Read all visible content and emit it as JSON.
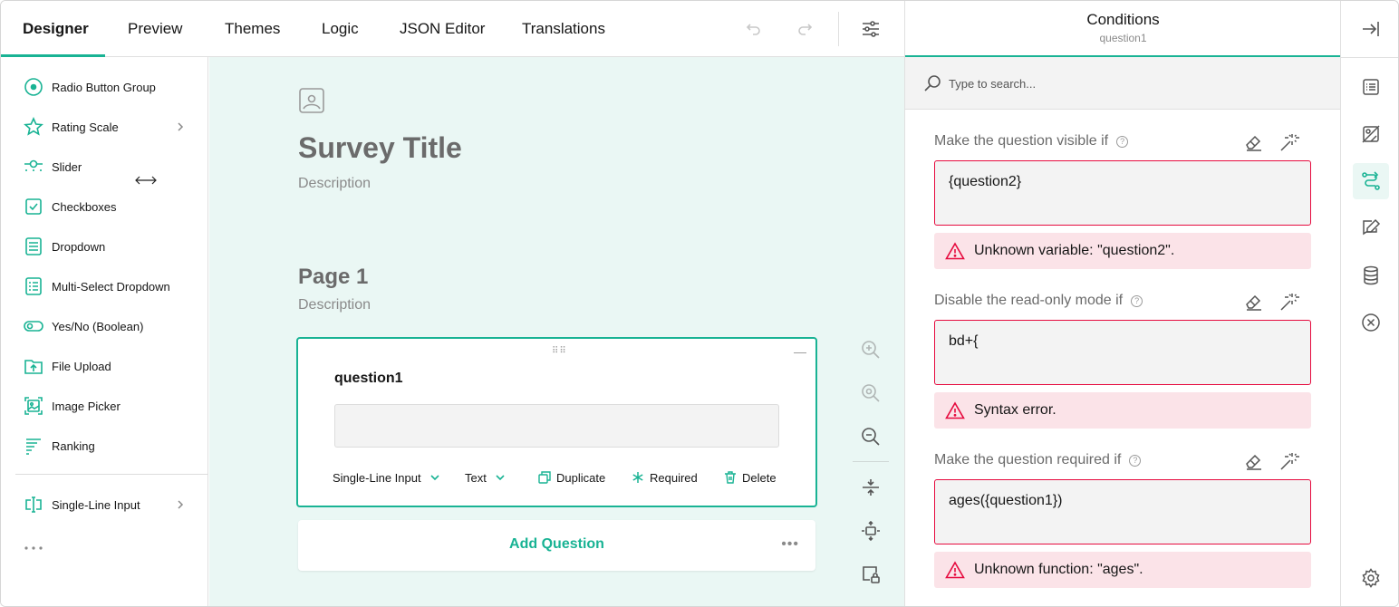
{
  "tabs": [
    {
      "label": "Designer",
      "active": true
    },
    {
      "label": "Preview"
    },
    {
      "label": "Themes"
    },
    {
      "label": "Logic"
    },
    {
      "label": "JSON Editor"
    },
    {
      "label": "Translations"
    }
  ],
  "toolbox": {
    "items": [
      {
        "label": "Radio Button Group",
        "icon": "radio-icon"
      },
      {
        "label": "Rating Scale",
        "icon": "star-icon",
        "has_submenu": true
      },
      {
        "label": "Slider",
        "icon": "slider-icon"
      },
      {
        "label": "Checkboxes",
        "icon": "checkbox-icon"
      },
      {
        "label": "Dropdown",
        "icon": "dropdown-icon"
      },
      {
        "label": "Multi-Select Dropdown",
        "icon": "multi-dropdown-icon"
      },
      {
        "label": "Yes/No (Boolean)",
        "icon": "toggle-icon"
      },
      {
        "label": "File Upload",
        "icon": "file-upload-icon"
      },
      {
        "label": "Image Picker",
        "icon": "image-picker-icon"
      },
      {
        "label": "Ranking",
        "icon": "ranking-icon"
      }
    ],
    "bottom_item": {
      "label": "Single-Line Input",
      "icon": "text-input-icon",
      "has_submenu": true
    }
  },
  "survey": {
    "title": "Survey Title",
    "description": "Description",
    "page": {
      "title": "Page 1",
      "description": "Description"
    }
  },
  "question": {
    "name": "question1",
    "type_label": "Single-Line Input",
    "input_type_label": "Text",
    "duplicate_label": "Duplicate",
    "required_label": "Required",
    "delete_label": "Delete"
  },
  "add_question": {
    "label": "Add Question"
  },
  "panel": {
    "title": "Conditions",
    "subtitle": "question1",
    "search_placeholder": "Type to search...",
    "properties": [
      {
        "label": "Make the question visible if",
        "value": "{question2}",
        "error": "Unknown variable: \"question2\"."
      },
      {
        "label": "Disable the read-only mode if",
        "value": "bd+{",
        "error": "Syntax error."
      },
      {
        "label": "Make the question required if",
        "value": "ages({question1})",
        "error": "Unknown function: \"ages\"."
      }
    ]
  },
  "colors": {
    "accent": "#19b394",
    "error": "#e60a3e",
    "error_bg": "#fbe3e8",
    "canvas_bg": "#eaf7f4"
  }
}
